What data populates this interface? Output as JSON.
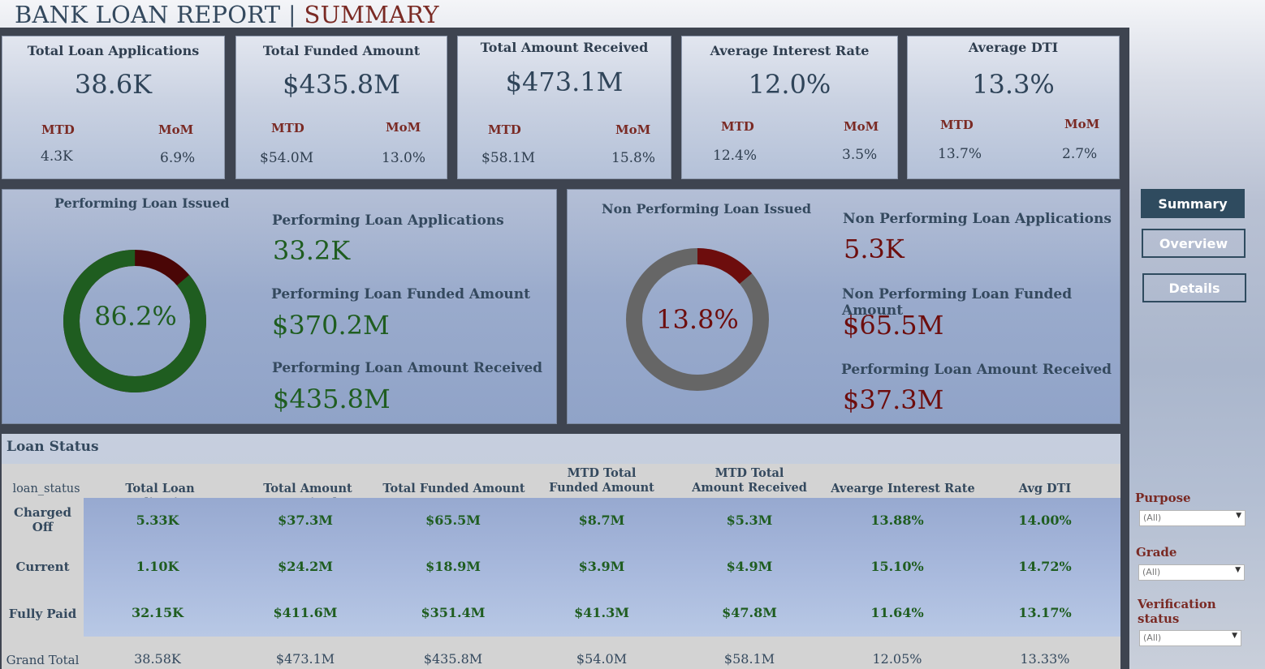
{
  "header": {
    "title": "BANK LOAN REPORT",
    "separator": "|",
    "subtitle": "SUMMARY"
  },
  "kpis": [
    {
      "title": "Total Loan Applications",
      "value": "38.6K",
      "mtd_label": "MTD",
      "mom_label": "MoM",
      "mtd": "4.3K",
      "mom": "6.9%"
    },
    {
      "title": "Total Funded Amount",
      "value": "$435.8M",
      "mtd_label": "MTD",
      "mom_label": "MoM",
      "mtd": "$54.0M",
      "mom": "13.0%"
    },
    {
      "title": "Total Amount Received",
      "value": "$473.1M",
      "mtd_label": "MTD",
      "mom_label": "MoM",
      "mtd": "$58.1M",
      "mom": "15.8%"
    },
    {
      "title": "Average Interest Rate",
      "value": "12.0%",
      "mtd_label": "MTD",
      "mom_label": "MoM",
      "mtd": "12.4%",
      "mom": "3.5%"
    },
    {
      "title": "Average DTI",
      "value": "13.3%",
      "mtd_label": "MTD",
      "mom_label": "MoM",
      "mtd": "13.7%",
      "mom": "2.7%"
    }
  ],
  "performing": {
    "title": "Performing Loan Issued",
    "donut_label": "86.2%",
    "share": 0.862,
    "apps_label": "Performing Loan Applications",
    "apps_value": "33.2K",
    "funded_label": "Performing Loan Funded Amount",
    "funded_value": "$370.2M",
    "received_label": "Performing Loan Amount Received",
    "received_value": "$435.8M"
  },
  "non_performing": {
    "title": "Non Performing Loan Issued",
    "donut_label": "13.8%",
    "share": 0.138,
    "apps_label": "Non Performing Loan Applications",
    "apps_value": "5.3K",
    "funded_label": "Non Performing Loan Funded Amount",
    "funded_value": "$65.5M",
    "received_label": "Performing Loan Amount Received",
    "received_value": "$37.3M"
  },
  "colors": {
    "green": "#1f5d20",
    "maroon": "#6d0d0d",
    "gray": "#666666",
    "dark_maroon": "#4a0606"
  },
  "loan_status": {
    "title": "Loan Status",
    "columns": {
      "status": "loan_status",
      "apps": "Total Loan Applications",
      "received": "Total Amount Received",
      "funded": "Total Funded Amount",
      "mtd_funded": "MTD Total Funded Amount",
      "mtd_received": "MTD Total  Amount Received",
      "rate": "Avearge Interest Rate",
      "dti": "Avg DTI"
    },
    "rows": [
      {
        "status": "Charged Off",
        "apps": "5.33K",
        "received": "$37.3M",
        "funded": "$65.5M",
        "mtd_funded": "$8.7M",
        "mtd_received": "$5.3M",
        "rate": "13.88%",
        "dti": "14.00%"
      },
      {
        "status": "Current",
        "apps": "1.10K",
        "received": "$24.2M",
        "funded": "$18.9M",
        "mtd_funded": "$3.9M",
        "mtd_received": "$4.9M",
        "rate": "15.10%",
        "dti": "14.72%"
      },
      {
        "status": "Fully Paid",
        "apps": "32.15K",
        "received": "$411.6M",
        "funded": "$351.4M",
        "mtd_funded": "$41.3M",
        "mtd_received": "$47.8M",
        "rate": "11.64%",
        "dti": "13.17%"
      }
    ],
    "total": {
      "status": "Grand Total",
      "apps": "38.58K",
      "received": "$473.1M",
      "funded": "$435.8M",
      "mtd_funded": "$54.0M",
      "mtd_received": "$58.1M",
      "rate": "12.05%",
      "dti": "13.33%"
    }
  },
  "nav": {
    "summary": "Summary",
    "overview": "Overview",
    "details": "Details"
  },
  "filters": {
    "purpose": {
      "label": "Purpose",
      "value": "(All)"
    },
    "grade": {
      "label": "Grade",
      "value": "(All)"
    },
    "verification": {
      "label": "Verification status",
      "value": "(All)"
    }
  }
}
